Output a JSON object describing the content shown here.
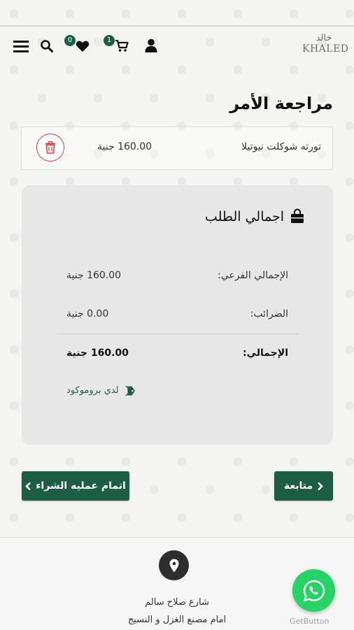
{
  "header": {
    "logo_arabic": "خالد",
    "logo_english": "KHALED",
    "wishlist_count": "0",
    "cart_count": "1",
    "icons": [
      "menu-icon",
      "search-icon",
      "heart-icon",
      "cart-icon",
      "user-icon"
    ]
  },
  "page": {
    "title": "مراجعة الأمر"
  },
  "cart_item": {
    "name": "تورته شوكلت نيوتيلا",
    "price": "160.00 جنية"
  },
  "summary": {
    "title": "اجمالي الطلب",
    "rows": [
      {
        "label": "الإجمالي الفرعي:",
        "value": "160.00 جنية"
      },
      {
        "label": "الضرائب:",
        "value": "0.00 جنية"
      }
    ],
    "total_label": "الإجمالي:",
    "total_value": "160.00 جنية",
    "promo_label": "لدي بروموكود"
  },
  "actions": {
    "checkout_label": "اتمام عمليه الشراء",
    "continue_label": "متابعة"
  },
  "footer": {
    "address_line1": "شارع صلاح سالم",
    "address_line2": "امام مصنع الغزل و النسيج",
    "getbutton_label": "GetButton"
  },
  "colors": {
    "brand_green": "#1c5d45",
    "delete_red": "#e53935",
    "whatsapp_green": "#25d366"
  }
}
